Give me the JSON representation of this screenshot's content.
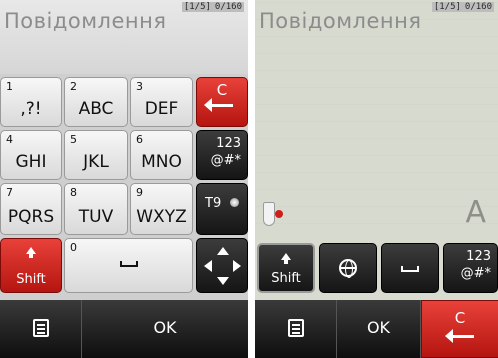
{
  "left_screen": {
    "title": "Повідомлення",
    "counter_page": "[1/5]",
    "counter_chars": "0/160",
    "keys": [
      {
        "num": "1",
        "label": ",?!"
      },
      {
        "num": "2",
        "label": "ABC"
      },
      {
        "num": "3",
        "label": "DEF"
      },
      {
        "num": "4",
        "label": "GHI"
      },
      {
        "num": "5",
        "label": "JKL"
      },
      {
        "num": "6",
        "label": "MNO"
      },
      {
        "num": "7",
        "label": "PQRS"
      },
      {
        "num": "8",
        "label": "TUV"
      },
      {
        "num": "9",
        "label": "WXYZ"
      },
      {
        "num": "0",
        "label": ""
      }
    ],
    "clear_label": "C",
    "mode_label_top": "123",
    "mode_label_bottom": "@#*",
    "t9_label": "T9",
    "shift_label": "Shift",
    "menu_icon": "menu-icon",
    "ok_label": "OK"
  },
  "right_screen": {
    "title": "Повідомлення",
    "counter_page": "[1/5]",
    "counter_chars": "0/160",
    "big_letter": "A",
    "shift_label": "Shift",
    "mode_label_top": "123",
    "mode_label_bottom": "@#*",
    "ok_label": "OK",
    "clear_label": "C"
  },
  "colors": {
    "accent_red": "#d02a22",
    "dark_key": "#1e1e1e",
    "light_key": "#e8e8e8"
  }
}
